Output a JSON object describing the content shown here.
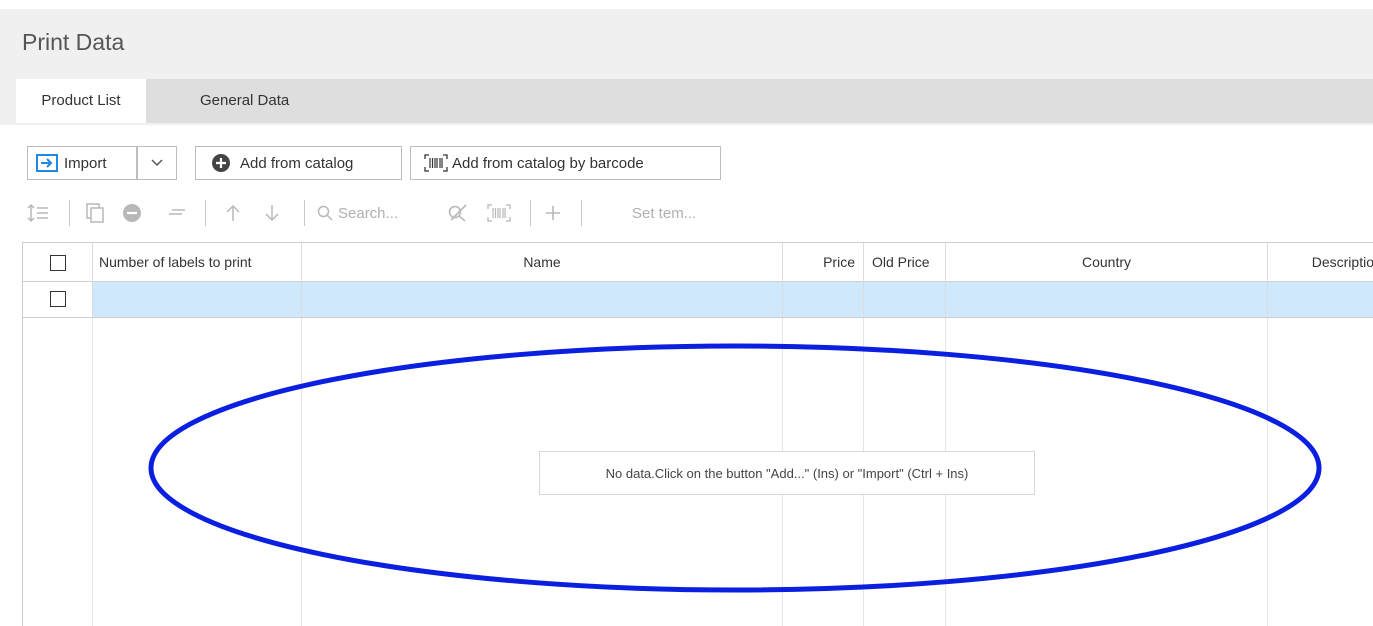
{
  "page": {
    "title": "Print Data"
  },
  "tabs": [
    {
      "label": "Product List",
      "active": true
    },
    {
      "label": "General Data",
      "active": false
    }
  ],
  "toolbar": {
    "import_label": "Import",
    "add_catalog_label": "Add from catalog",
    "add_barcode_label": "Add from catalog by barcode",
    "search_placeholder": "Search...",
    "set_item_placeholder": "Set tem..."
  },
  "grid": {
    "columns": [
      "Number of labels to print",
      "Name",
      "Price",
      "Old Price",
      "Country",
      "Descriptio"
    ],
    "empty_message": "No data.Click on the button \"Add...\" (Ins) or \"Import\" (Ctrl + Ins)"
  },
  "colors": {
    "accent": "#1e88e5",
    "selected_row": "#cfe8fb",
    "annotation": "#0a1fe0"
  }
}
